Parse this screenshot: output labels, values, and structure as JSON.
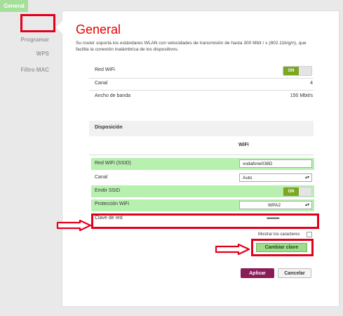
{
  "sidebar": {
    "items": [
      {
        "label": "General"
      },
      {
        "label": "Programar"
      },
      {
        "label": "WPS"
      },
      {
        "label": "Filtro MAC"
      }
    ]
  },
  "main": {
    "title": "General",
    "description": "Su router soporta los estándares WLAN con velocidades de transmisión de hasta 300 Mbit / s (802.11b/g/n), que facilita la conexión inalámbrica de los dispositivos.",
    "red_wifi_label": "Red WiFi",
    "red_wifi_toggle": "ON",
    "canal_label": "Canal",
    "canal_value": "4",
    "ancho_label": "Ancho de banda",
    "ancho_value": "150 Mbit/s"
  },
  "disposicion": {
    "title": "Disposición",
    "column_header": "WiFi",
    "ssid_label": "Red WiFi (SSID)",
    "ssid_value": "vodafone038D",
    "canal_label": "Canal",
    "canal_value": "Auto",
    "emitir_label": "Emitir SSID",
    "emitir_toggle": "ON",
    "proteccion_label": "Protección WiFi",
    "proteccion_value": "WPA2",
    "clave_label": "Clave de red",
    "clave_value": "••••••••••••••••",
    "mostrar_label": "Mostrar los caracteres",
    "cambiar_label": "Cambiar clave"
  },
  "actions": {
    "apply_label": "Aplicar",
    "cancel_label": "Cancelar"
  },
  "colors": {
    "accent_red": "#e60000",
    "highlight_green": "#b8f0b0",
    "apply_purple": "#8a1c57",
    "annotation_red": "#e3001b"
  }
}
